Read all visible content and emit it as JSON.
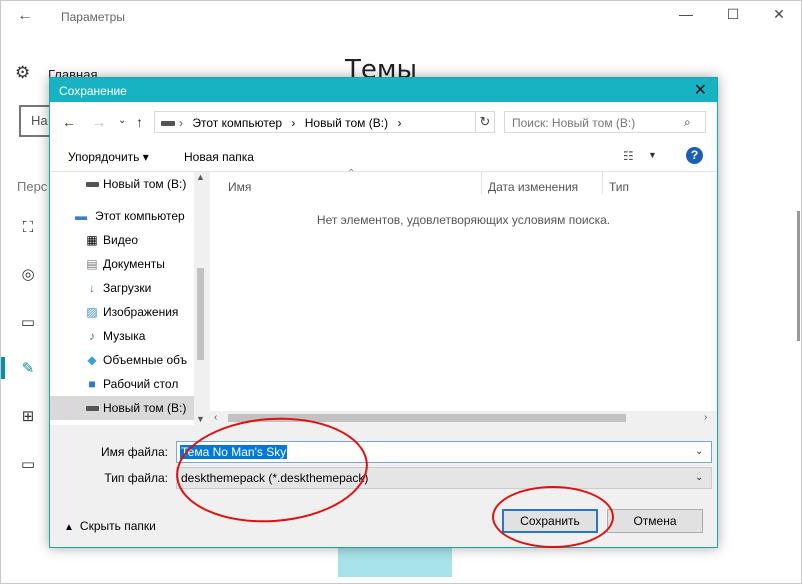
{
  "settings": {
    "title": "Параметры",
    "home_label": "Главная",
    "heading": "Темы",
    "search_value": "На",
    "section_label": "Перс",
    "window_controls": [
      "—",
      "☐",
      "✕"
    ]
  },
  "dialog": {
    "title": "Сохранение",
    "close": "✕",
    "nav": {
      "back": "←",
      "forward": "→",
      "recent": "⌄",
      "up": "↑"
    },
    "address": {
      "crumbs": [
        "Этот компьютер",
        "›",
        "Новый том (B:)",
        "›"
      ],
      "dropdown": "⌄",
      "refresh": "↻",
      "lead_separator": "›"
    },
    "search_placeholder": "Поиск: Новый том (B:)",
    "toolbar": {
      "organize": "Упорядочить ▾",
      "new_folder": "Новая папка",
      "view_icon": "☷",
      "view_arrow": "▼",
      "help": "?"
    },
    "tree": [
      {
        "label": "Новый том (B:)",
        "icon": "drive-icon"
      },
      {
        "label": "Этот компьютер",
        "icon": "computer-icon"
      },
      {
        "label": "Видео",
        "icon": "video-icon"
      },
      {
        "label": "Документы",
        "icon": "documents-icon"
      },
      {
        "label": "Загрузки",
        "icon": "downloads-icon"
      },
      {
        "label": "Изображения",
        "icon": "pictures-icon"
      },
      {
        "label": "Музыка",
        "icon": "music-icon"
      },
      {
        "label": "Объемные объ",
        "icon": "3d-objects-icon"
      },
      {
        "label": "Рабочий стол",
        "icon": "desktop-icon"
      },
      {
        "label": "Новый том (B:)",
        "icon": "drive-icon"
      }
    ],
    "columns": [
      "Имя",
      "Дата изменения",
      "Тип"
    ],
    "empty_message": "Нет элементов, удовлетворяющих условиям поиска.",
    "filename_label": "Имя файла:",
    "filename_value": "Тема No Man's Sky",
    "filetype_label": "Тип файла:",
    "filetype_value": "deskthemepack (*.deskthemepack)",
    "hide_folders": "Скрыть папки",
    "save_button": "Сохранить",
    "cancel_button": "Отмена"
  },
  "colors": {
    "titlebar": "#17b3c3",
    "annotation": "#e01010",
    "selection": "#0078d7"
  }
}
